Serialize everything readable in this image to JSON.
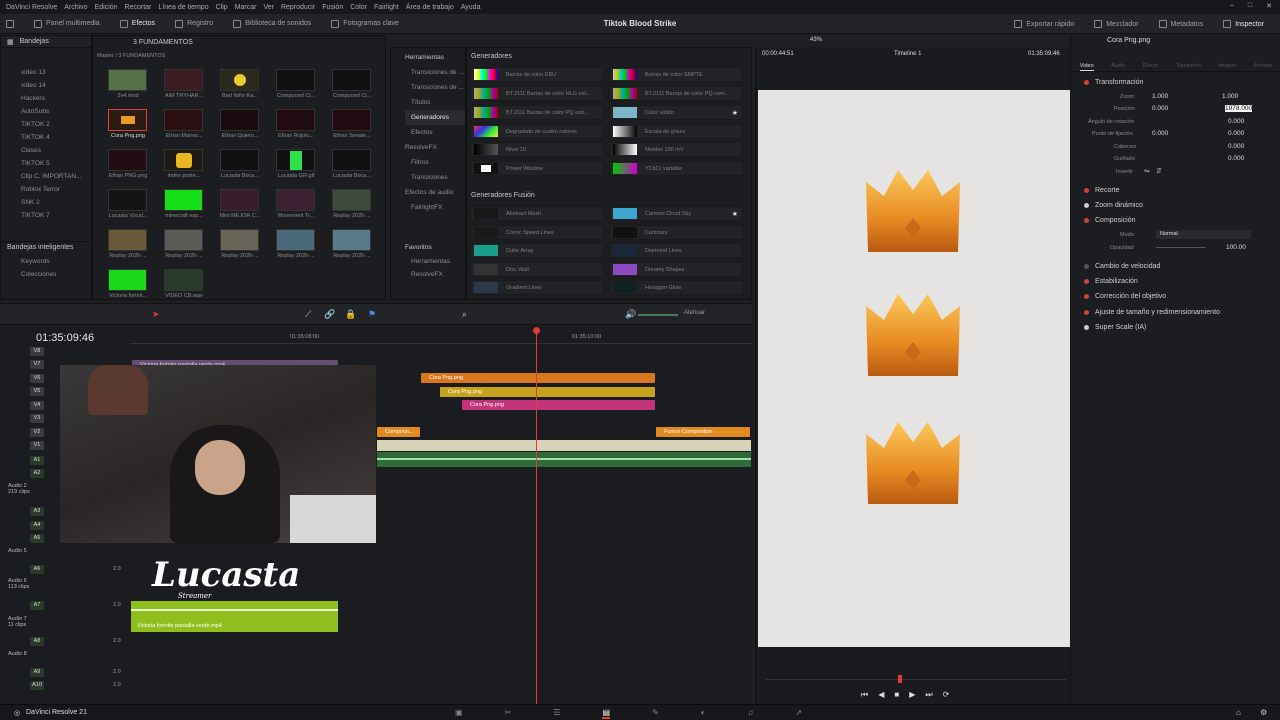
{
  "menu": [
    "DaVinci Resolve",
    "Archivo",
    "Edición",
    "Recortar",
    "Línea de tiempo",
    "Clip",
    "Marcar",
    "Ver",
    "Reproducir",
    "Fusión",
    "Color",
    "Fairlight",
    "Área de trabajo",
    "Ayuda"
  ],
  "toolbar": {
    "left": [
      "Panel multimedia",
      "Efectos",
      "Registro",
      "Biblioteca de sonidos",
      "Fotogramas clave"
    ],
    "right": [
      "Exportar rápido",
      "Mezclador",
      "Metadatos",
      "Inspector"
    ],
    "project_title": "Tiktok Blood Strike"
  },
  "media_pool": {
    "bins_title": "Bandejas",
    "breadcrumb": "Master / 3 FUNDAMENTOS",
    "folder_label": "3 FUNDAMENTOS",
    "bins": [
      "video 13",
      "video 14",
      "Hackers",
      "AutoSubs",
      "TIKTOK 2",
      "TIKTOK 4",
      "Clases",
      "TIKTOK 5",
      "Clip C. IMPORTAN...",
      "Roblox Terror",
      "SNK 2",
      "TIKTOK 7"
    ],
    "smart_bins_title": "Bandejas inteligentes",
    "smart_bins": [
      "Keywords",
      "Colecciones"
    ],
    "thumbs": [
      "2v4.mod",
      "AIM TRYHAR...",
      "Bart Niño Ra...",
      "Compound Cl...",
      "Compound Cl...",
      "Cora Png.png",
      "Ethan Manos...",
      "Ethan Quieto...",
      "Ethan Rojolu...",
      "Ethan Senale...",
      "Ethan PNG.png",
      "index poste...",
      "Lucasta Boca...",
      "Lucasta GIF.gif",
      "Lucasta Boca...",
      "Lucasta Vocal...",
      "minecraft esp...",
      "Mini MEJOR C...",
      "Movement Tr...",
      "Replay 2026-...",
      "Replay 2026-...",
      "Replay 2026-...",
      "Replay 2026-...",
      "Replay 2026-...",
      "Replay 2026-...",
      "Victoria fortnit...",
      "VIDEO CB.wav"
    ]
  },
  "effects": {
    "tree_title": "Herramientas",
    "tree": [
      "Transiciones de ...",
      "Transiciones de ...",
      "Títulos",
      "Generadores",
      "Efectos",
      "ResolveFX",
      "Filtros",
      "Transiciones",
      "Efectos de audio",
      "FairlightFX"
    ],
    "favorites_title": "Favoritos",
    "favorites": [
      "Herramientas",
      "ResolveFX"
    ],
    "generators_title": "Generadores",
    "generators": [
      "Barras de color EBU",
      "Barras de color SMPTE",
      "BT.2111 Barras de color HLG est...",
      "BT.2111 Barras de color PQ com...",
      "BT.2111 Barras de color PQ estr...",
      "Color sólido",
      "Degradado de cuatro colores",
      "Escala de grises",
      "Nivel 10",
      "Niveles 100 mV",
      "Power Window",
      "YCbCr variable"
    ],
    "fusion_title": "Generadores Fusión",
    "fusion": [
      "Abstract Mesh",
      "Cartoon Cloud Sky",
      "Comic Speed Lines",
      "Contours",
      "Cube Array",
      "Diamond Lines",
      "Disc Wall",
      "Dreamy Shapes",
      "Gradient Lines",
      "Hexagon Glow"
    ]
  },
  "timeline": {
    "timecode": "01:35:09:46",
    "ruler": [
      "01:35:08:00",
      "01:35:10:00"
    ],
    "attenuate": "Atenuar",
    "tracks": [
      "V8",
      "V7",
      "V6",
      "V5",
      "V4",
      "V3",
      "V2",
      "V1",
      "A1",
      "A2",
      "A3",
      "A4",
      "A5",
      "A6",
      "A7",
      "A8",
      "A9",
      "A10"
    ],
    "audio_groups": [
      {
        "name": "Audio 2",
        "sub": "219 clips"
      },
      {
        "name": "Audio 5",
        "sub": ""
      },
      {
        "name": "Audio 6",
        "sub": "113 clips"
      },
      {
        "name": "Audio 7",
        "sub": "11 clips"
      },
      {
        "name": "Audio 8",
        "sub": ""
      }
    ],
    "track_level": "2.0",
    "clips": {
      "v8_clip": "Victoria fortnite pantalla verde.mp4",
      "v6_clip": "Cora Png.png",
      "v5_clip": "Cora Png.png",
      "v4_clip": "Cora Png.png",
      "v2_left": "Compoun...",
      "v2_right": "Fusion Composition",
      "a7_clip": "Victoria fortnite pantalla verde.mp4"
    },
    "streamer_name": "Lucasta",
    "streamer_tag": "Streamer"
  },
  "viewer": {
    "timecode_left": "00:00:44:51",
    "zoom": "43%",
    "timeline_name": "Timeline 1",
    "timecode_right": "01:35:09:46"
  },
  "inspector": {
    "clip_name": "Cora Png.png",
    "tabs": [
      "Video",
      "Audio",
      "Efecto",
      "Transición",
      "Imagen",
      "Archivo"
    ],
    "sections": [
      "Transformación",
      "Recorte",
      "Zoom dinámico",
      "Composición",
      "Cambio de velocidad",
      "Estabilización",
      "Corrección del objetivo",
      "Ajuste de tamaño y redimensionamiento",
      "Super Scale (IA)"
    ],
    "transform": {
      "zoom_label": "Zoom",
      "zoom_x": "1.000",
      "zoom_y": "1.000",
      "pos_label": "Posición",
      "pos_x": "0.000",
      "pos_y": "1978.000",
      "rot_label": "Ángulo de rotación",
      "rot": "0.000",
      "anchor_label": "Punto de fijación",
      "anchor_x": "0.000",
      "anchor_y": "0.000",
      "pitch_label": "Cabeceo",
      "pitch": "0.000",
      "yaw_label": "Guiñado",
      "yaw": "0.000",
      "flip_label": "Invertir"
    },
    "composite": {
      "mode_label": "Modo",
      "mode": "Normal",
      "opacity_label": "Opacidad",
      "opacity": "100.00"
    }
  },
  "bottom": {
    "app": "DaVinci Resolve 21"
  },
  "colors": {
    "orange": "#d9771f",
    "yellow": "#c9a21d",
    "pink": "#c2357a",
    "green_audio": "#2f6a3a",
    "lime_audio": "#8fbf1f",
    "playhead": "#e03a3a",
    "accent_red": "#c8463c"
  }
}
